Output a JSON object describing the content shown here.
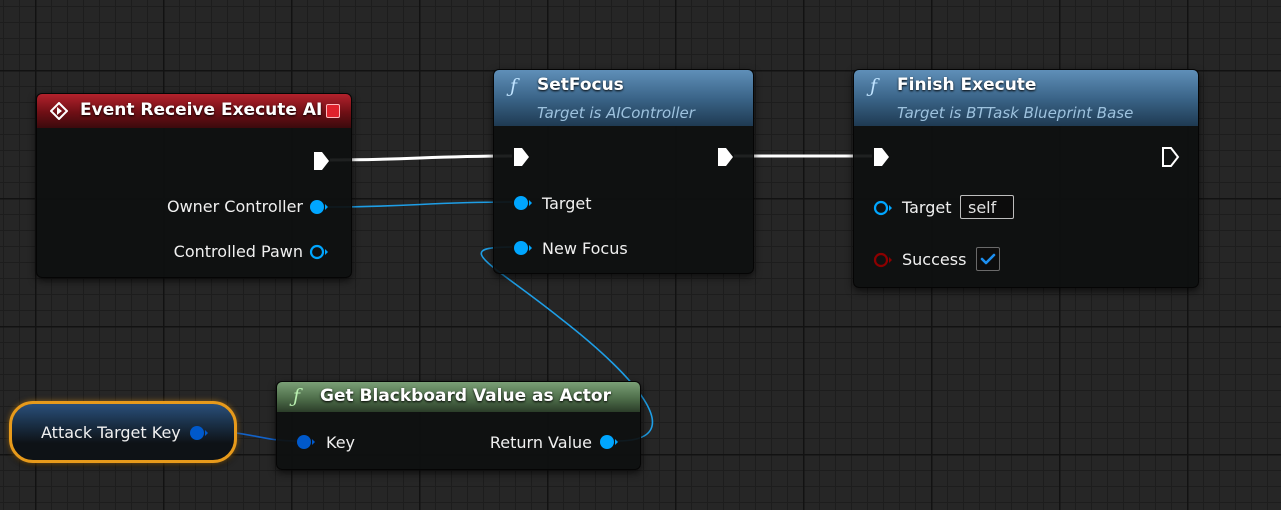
{
  "nodes": {
    "event_receive_execute_ai": {
      "title": "Event Receive Execute AI",
      "outputs": {
        "owner_controller": "Owner Controller",
        "controlled_pawn": "Controlled Pawn"
      }
    },
    "set_focus": {
      "icon_glyph": "ƒ",
      "title": "SetFocus",
      "subtitle": "Target is AIController",
      "inputs": {
        "target": "Target",
        "new_focus": "New Focus"
      }
    },
    "finish_execute": {
      "icon_glyph": "ƒ",
      "title": "Finish Execute",
      "subtitle": "Target is BTTask Blueprint Base",
      "inputs": {
        "target": "Target",
        "target_default": "self",
        "success": "Success",
        "success_checked": true
      }
    },
    "get_blackboard_value_as_actor": {
      "icon_glyph": "ƒ",
      "title": "Get Blackboard Value as Actor",
      "inputs": {
        "key": "Key"
      },
      "outputs": {
        "return_value": "Return Value"
      }
    },
    "attack_target_key": {
      "label": "Attack Target Key"
    }
  },
  "icons": {
    "event": "event-diamond-icon",
    "function": "function-icon",
    "exec_pin": "exec-pin-icon",
    "object_pin": "object-pin-icon",
    "struct_pin": "struct-pin-icon",
    "bool_pin": "bool-pin-icon",
    "check": "checkmark-icon",
    "stop": "stop-square-icon"
  },
  "colors": {
    "event_header": "#b3222c",
    "function_header": "#3b6589",
    "pure_header": "#4e6e4a",
    "object_pin": "#00a6ff",
    "struct_pin": "#0059cb",
    "bool_pin": "#8c0000",
    "exec_wire": "#ffffff",
    "selection": "#e79a1b"
  }
}
